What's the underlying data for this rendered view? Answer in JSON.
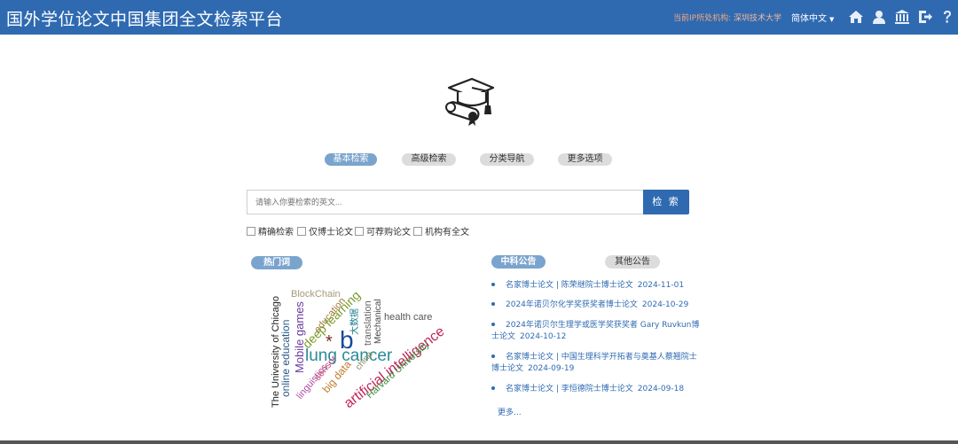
{
  "header": {
    "title": "国外学位论文中国集团全文检索平台",
    "ip_label": "当前IP所处机构:",
    "institution": "深圳技术大学",
    "language": "简体中文",
    "icons": [
      "home-icon",
      "user-icon",
      "institution-icon",
      "logout-icon",
      "help-icon"
    ]
  },
  "tabs": [
    {
      "label": "基本检索",
      "active": true
    },
    {
      "label": "高级检索",
      "active": false
    },
    {
      "label": "分类导航",
      "active": false
    },
    {
      "label": "更多选项",
      "active": false
    }
  ],
  "search": {
    "placeholder": "请输入你要检索的英文...",
    "button_label": "检 索"
  },
  "options": [
    "精确检索",
    "仅博士论文",
    "可荐购论文",
    "机构有全文"
  ],
  "hot_words": {
    "label": "热门词",
    "words": [
      "BlockChain",
      "education",
      "deep learning",
      "大数据",
      "translation",
      "Mechanical",
      "health care",
      "The University of Chicago",
      "online education",
      "Mobile games",
      "b",
      "lung cancer",
      "linguistics",
      "sensor",
      "big data",
      "china",
      "artificial intelligence",
      "Harvard University"
    ]
  },
  "announcements": {
    "tab_active": "中科公告",
    "tab_other": "其他公告",
    "items": [
      {
        "text": "名家博士论文 | 陈荣继院士博士论文",
        "date": "2024-11-01"
      },
      {
        "text": "2024年诺贝尔化学奖获奖者博士论文",
        "date": "2024-10-29"
      },
      {
        "text": "2024年诺贝尔生理学或医学奖获奖者 Gary Ruvkun博士论文",
        "date": "2024-10-12"
      },
      {
        "text": "名家博士论文 | 中国生理科学开拓者与奠基人蔡翘院士博士论文",
        "date": "2024-09-19"
      },
      {
        "text": "名家博士论文 | 李恒德院士博士论文",
        "date": "2024-09-18"
      }
    ],
    "more_label": "更多..."
  },
  "colors": {
    "header_bg": "#2f6ab1",
    "accent_tab": "#7aa4cd",
    "inactive_tab": "#dcdcdc",
    "ip_text": "#f3a77c"
  }
}
